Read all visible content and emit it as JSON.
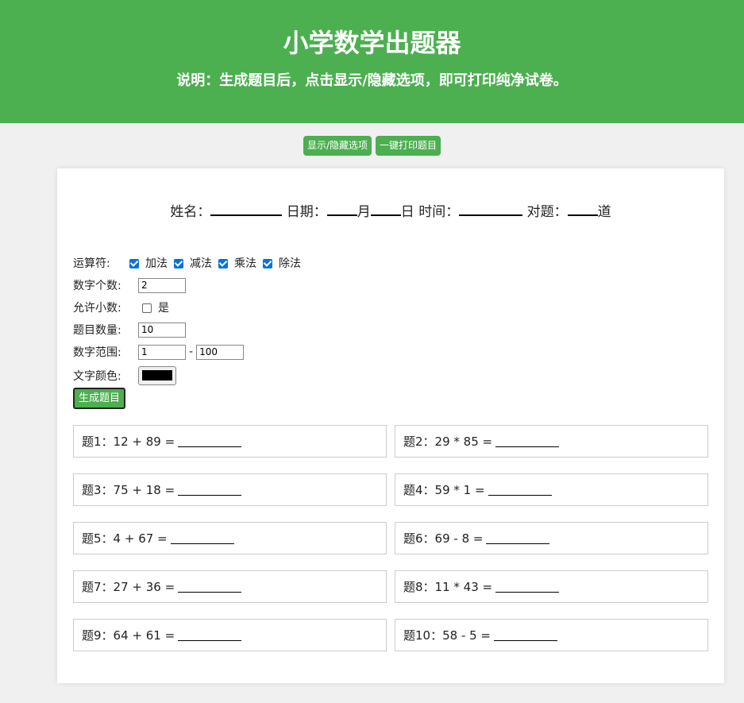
{
  "header": {
    "title": "小学数学出题器",
    "subtitle": "说明：生成题目后，点击显示/隐藏选项，即可打印纯净试卷。"
  },
  "toolbar": {
    "toggle_label": "显示/隐藏选项",
    "print_label": "一键打印题目"
  },
  "info": {
    "name_label": "姓名：",
    "date_label": "日期：",
    "month_label": "月",
    "day_label": "日",
    "time_label": "时间：",
    "correct_label": "对题：",
    "correct_unit": "道"
  },
  "options": {
    "operator_label": "运算符:",
    "operators": [
      {
        "label": "加法",
        "checked": true
      },
      {
        "label": "减法",
        "checked": true
      },
      {
        "label": "乘法",
        "checked": true
      },
      {
        "label": "除法",
        "checked": true
      }
    ],
    "count_label": "数字个数:",
    "count_value": "2",
    "decimal_label": "允许小数:",
    "decimal_option": "是",
    "decimal_checked": false,
    "qty_label": "题目数量:",
    "qty_value": "10",
    "range_label": "数字范围:",
    "range_min": "1",
    "range_sep": "-",
    "range_max": "100",
    "color_label": "文字颜色:",
    "color_value": "#000000",
    "generate_label": "生成题目"
  },
  "questions": [
    "题1：12 + 89 =",
    "题2：29 * 85 =",
    "题3：75 + 18 =",
    "题4：59 * 1 =",
    "题5：4 + 67 =",
    "题6：69 - 8 =",
    "题7：27 + 36 =",
    "题8：11 * 43 =",
    "题9：64 + 61 =",
    "题10：58 - 5 ="
  ],
  "colors": {
    "accent": "#4caf50",
    "checkbox": "#0b73d6"
  }
}
